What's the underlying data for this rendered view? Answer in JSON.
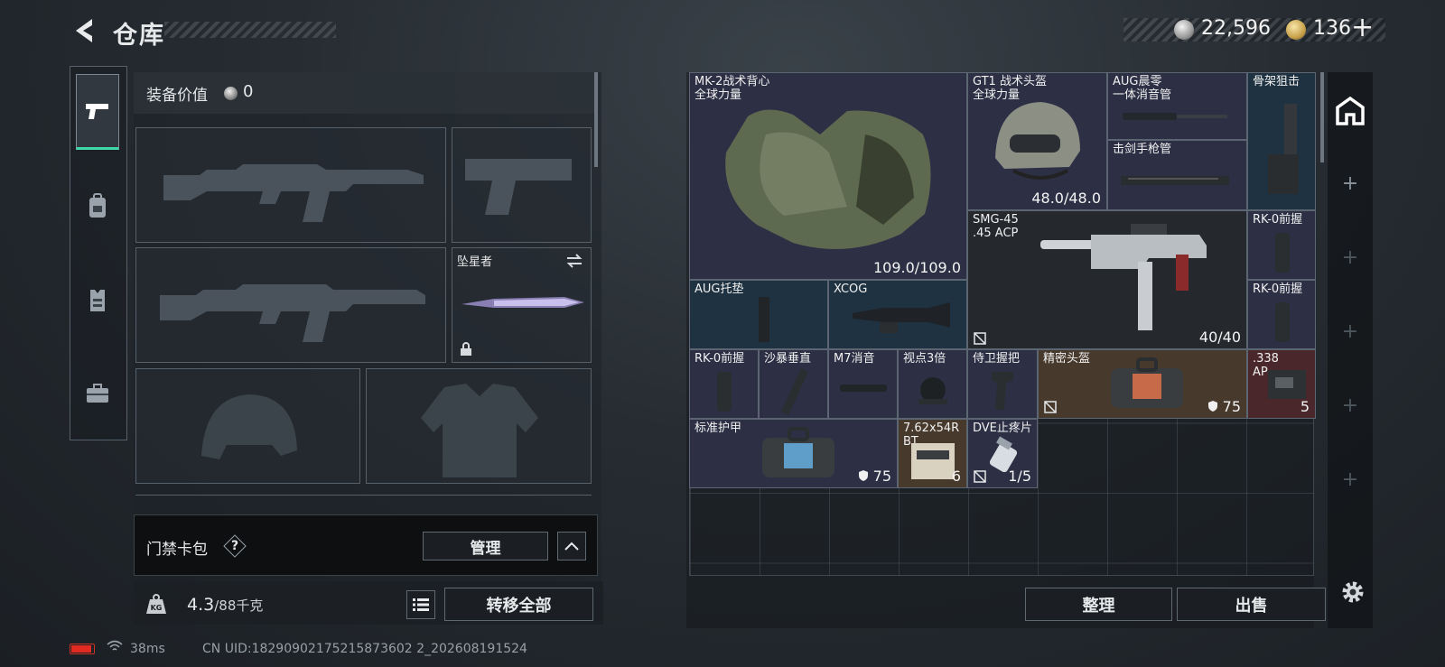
{
  "header": {
    "title": "仓库",
    "silver": "22,596",
    "gold": "136",
    "plus": "+"
  },
  "left": {
    "equip_value_label": "装备价值",
    "equip_value": "0",
    "melee_name": "坠星者",
    "access_label": "门禁卡包",
    "help": "?",
    "manage": "管理",
    "weight": "4.3",
    "weight_max": "/88千克",
    "transfer_all": "转移全部"
  },
  "stash": {
    "items": [
      {
        "id": "vest",
        "name": "MK-2战术背心\n全球力量",
        "value": "109.0/109.0"
      },
      {
        "id": "helmet",
        "name": "GT1 战术头盔\n全球力量",
        "value": "48.0/48.0"
      },
      {
        "id": "aug-supp",
        "name": "AUG晨零\n一体消音管",
        "value": ""
      },
      {
        "id": "sniper-stock",
        "name": "骨架狙击",
        "value": ""
      },
      {
        "id": "barrel",
        "name": "击剑手枪管",
        "value": ""
      },
      {
        "id": "smg",
        "name": "SMG-45\n.45 ACP",
        "value": "40/40"
      },
      {
        "id": "rk0-a",
        "name": "RK-0前握",
        "value": ""
      },
      {
        "id": "rk0-b",
        "name": "RK-0前握",
        "value": ""
      },
      {
        "id": "aug-stock",
        "name": "AUG托垫",
        "value": ""
      },
      {
        "id": "xcog",
        "name": "XCOG",
        "value": ""
      },
      {
        "id": "rk0-c",
        "name": "RK-0前握",
        "value": ""
      },
      {
        "id": "vertical",
        "name": "沙暴垂直",
        "value": ""
      },
      {
        "id": "m7",
        "name": "M7消音",
        "value": ""
      },
      {
        "id": "scope3x",
        "name": "视点3倍",
        "value": ""
      },
      {
        "id": "guard-grip",
        "name": "侍卫握把",
        "value": ""
      },
      {
        "id": "precision-helmet",
        "name": "精密头盔",
        "value": "75"
      },
      {
        "id": "ammo338",
        "name": ".338\nAP",
        "value": "5"
      },
      {
        "id": "std-armor",
        "name": "标准护甲",
        "value": "75"
      },
      {
        "id": "ammo762",
        "name": "7.62x54R\nBT",
        "value": "6"
      },
      {
        "id": "painkiller",
        "name": "DVE止疼片",
        "value": "1/5"
      }
    ],
    "sort": "整理",
    "sell": "出售"
  },
  "status": {
    "ping": "38ms",
    "uid": "CN UID:18290902175215873602 2_202608191524"
  },
  "icons": {
    "back": "back-arrow-icon",
    "pistol": "pistol-icon",
    "backpack": "backpack-icon",
    "rig": "rig-icon",
    "case": "briefcase-icon",
    "kg": "weight-icon",
    "list": "list-icon",
    "gear": "gear-icon",
    "home": "home-icon"
  },
  "colors": {
    "accent": "#3fd8a8",
    "purple": "#2d2f45",
    "blue": "#1f3241",
    "gold": "#47392c",
    "red": "#4a272b"
  }
}
